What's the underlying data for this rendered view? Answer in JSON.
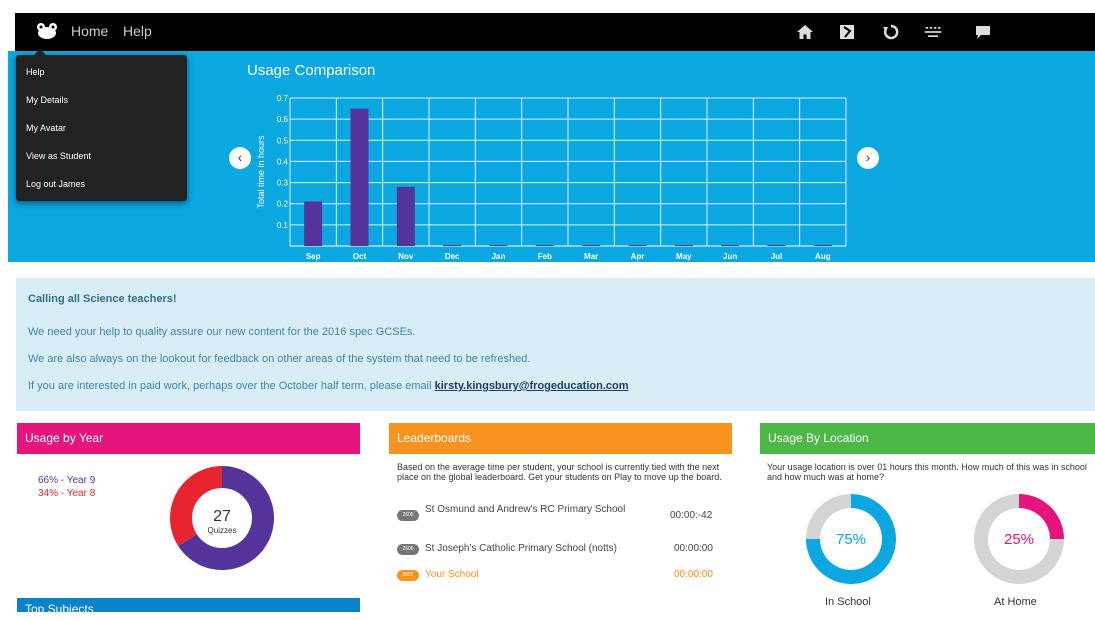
{
  "nav": {
    "home": "Home",
    "help": "Help",
    "icons": [
      "home-icon",
      "bookmark-icon",
      "refresh-icon",
      "menu-icon",
      "chat-icon"
    ]
  },
  "dropdown": {
    "items": [
      "Help",
      "My Details",
      "My Avatar",
      "View as Student",
      "Log out James"
    ]
  },
  "usage_chart": {
    "title": "Usage Comparison",
    "prev": "‹",
    "next": "›"
  },
  "chart_data": {
    "type": "bar",
    "title": "Usage Comparison",
    "ylabel": "Total time in hours",
    "xlabel": "",
    "categories": [
      "Sep",
      "Oct",
      "Nov",
      "Dec",
      "Jan",
      "Feb",
      "Mar",
      "Apr",
      "May",
      "Jun",
      "Jul",
      "Aug"
    ],
    "values": [
      0.21,
      0.65,
      0.28,
      0,
      0,
      0,
      0,
      0,
      0,
      0,
      0,
      0
    ],
    "ylim": [
      0,
      0.7
    ],
    "yticks": [
      0.1,
      0.2,
      0.3,
      0.4,
      0.5,
      0.6,
      0.7
    ],
    "grid": true,
    "bar_color": "#54339a"
  },
  "notice": {
    "heading": "Calling all Science teachers!",
    "line1": "We need your help to quality assure our new content for the 2016 spec GCSEs.",
    "line2": "We are also always on the lookout for feedback on other areas of the system that need to be refreshed.",
    "line3": "If you are interested in paid work, perhaps over the October half term, please email",
    "email": "kirsty.kingsbury@frogeducation.com"
  },
  "usage_by_year": {
    "title": "Usage by Year",
    "legend": [
      "66% - Year 9",
      "34% - Year 8"
    ],
    "fractions": [
      0.66,
      0.34
    ],
    "colors": [
      "#54339a",
      "#e8252f"
    ],
    "center_number": "27",
    "center_label": "Quizzes"
  },
  "top_subjects": {
    "title": "Top Subjects"
  },
  "leaderboards": {
    "title": "Leaderboards",
    "intro": "Based on the average time per student, your school is currently tied with the next place on the global leaderboard. Get your students on Play to move up the board.",
    "rows": [
      {
        "rank": "2605",
        "name": "St Osmund and Andrew's RC Primary School",
        "time": "00:00:-42"
      },
      {
        "rank": "2606",
        "name": "St Joseph's Catholic Primary School (notts)",
        "time": "00:00:00"
      },
      {
        "rank": "2607",
        "name": "Your School",
        "time": "00:00:00"
      }
    ]
  },
  "usage_by_location": {
    "title": "Usage By Location",
    "intro": "Your usage location is over 01 hours this month. How much of this was in school and how much was at home?",
    "in_school": {
      "pct": "75%",
      "value": 0.75,
      "label": "In School",
      "color": "#0aa7e0"
    },
    "at_home": {
      "pct": "25%",
      "value": 0.25,
      "label": "At Home",
      "color": "#e5157d"
    }
  },
  "colors": {
    "topbar": "#000000",
    "hero": "#0aa7e0",
    "pink": "#e5157d",
    "orange": "#f7931e",
    "green": "#4db748",
    "blue": "#0a82c8",
    "notice_bg": "#d9edf7"
  }
}
